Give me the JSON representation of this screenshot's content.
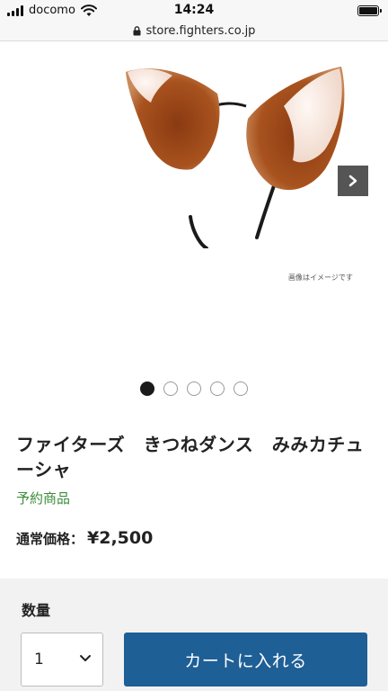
{
  "status_bar": {
    "carrier": "docomo",
    "time": "14:24"
  },
  "browser": {
    "url": "store.fighters.co.jp"
  },
  "product": {
    "image_note": "画像はイメージです",
    "gallery_count": 5,
    "gallery_active_index": 0,
    "title": "ファイターズ　きつねダンス　みみカチューシャ",
    "badge": "予約商品",
    "price_label": "通常価格：",
    "price": "¥2,500"
  },
  "purchase": {
    "quantity_label": "数量",
    "quantity_value": "1",
    "cart_button_label": "カートに入れる"
  },
  "colors": {
    "cart_button": "#1e5f96",
    "preorder_text": "#3b8d3b",
    "purchase_bg": "#f2f2f2"
  }
}
